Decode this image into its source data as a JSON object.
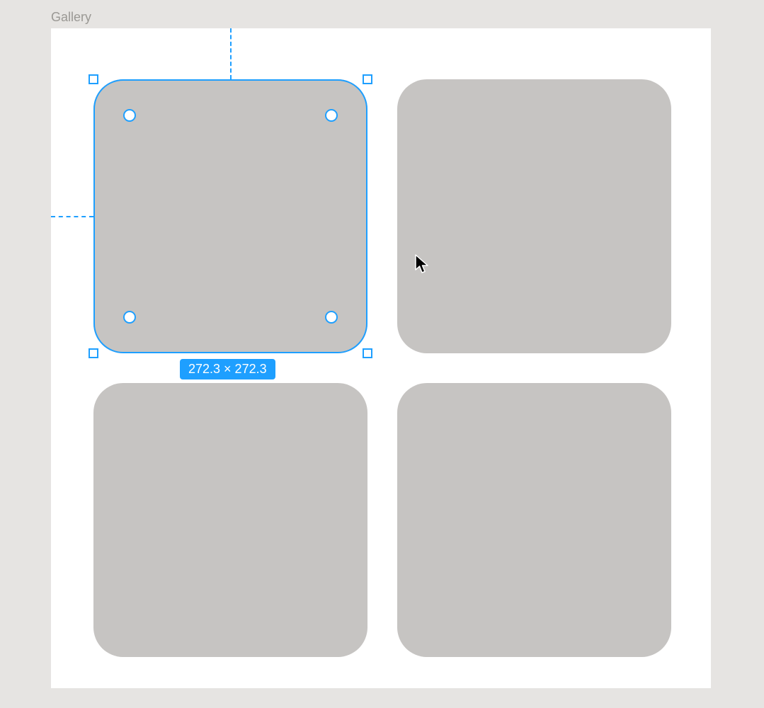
{
  "frame": {
    "label": "Gallery"
  },
  "selection": {
    "dimensions_label": "272.3 × 272.3",
    "width": 272.3,
    "height": 272.3
  },
  "colors": {
    "accent": "#1e9fff",
    "item_fill": "#c6c4c2",
    "canvas_bg": "#e6e4e2",
    "frame_bg": "#ffffff"
  },
  "gallery": {
    "items": [
      {
        "id": "item-1",
        "selected": true
      },
      {
        "id": "item-2",
        "selected": false
      },
      {
        "id": "item-3",
        "selected": false
      },
      {
        "id": "item-4",
        "selected": false
      }
    ]
  }
}
